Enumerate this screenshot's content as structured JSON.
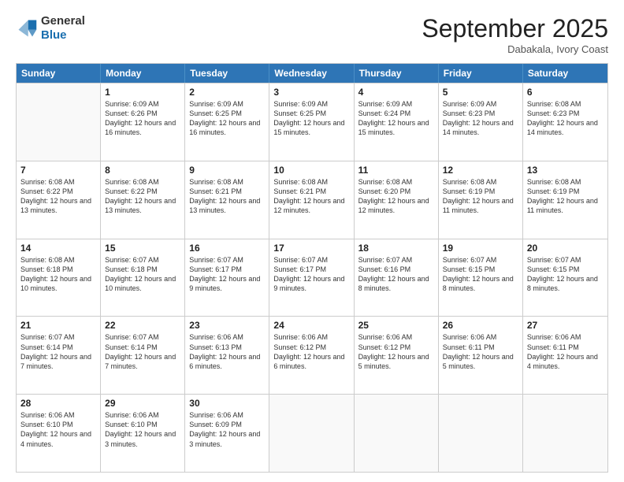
{
  "header": {
    "logo_general": "General",
    "logo_blue": "Blue",
    "month": "September 2025",
    "location": "Dabakala, Ivory Coast"
  },
  "days_of_week": [
    "Sunday",
    "Monday",
    "Tuesday",
    "Wednesday",
    "Thursday",
    "Friday",
    "Saturday"
  ],
  "rows": [
    [
      {
        "day": "",
        "sunrise": "",
        "sunset": "",
        "daylight": ""
      },
      {
        "day": "1",
        "sunrise": "Sunrise: 6:09 AM",
        "sunset": "Sunset: 6:26 PM",
        "daylight": "Daylight: 12 hours and 16 minutes."
      },
      {
        "day": "2",
        "sunrise": "Sunrise: 6:09 AM",
        "sunset": "Sunset: 6:25 PM",
        "daylight": "Daylight: 12 hours and 16 minutes."
      },
      {
        "day": "3",
        "sunrise": "Sunrise: 6:09 AM",
        "sunset": "Sunset: 6:25 PM",
        "daylight": "Daylight: 12 hours and 15 minutes."
      },
      {
        "day": "4",
        "sunrise": "Sunrise: 6:09 AM",
        "sunset": "Sunset: 6:24 PM",
        "daylight": "Daylight: 12 hours and 15 minutes."
      },
      {
        "day": "5",
        "sunrise": "Sunrise: 6:09 AM",
        "sunset": "Sunset: 6:23 PM",
        "daylight": "Daylight: 12 hours and 14 minutes."
      },
      {
        "day": "6",
        "sunrise": "Sunrise: 6:08 AM",
        "sunset": "Sunset: 6:23 PM",
        "daylight": "Daylight: 12 hours and 14 minutes."
      }
    ],
    [
      {
        "day": "7",
        "sunrise": "Sunrise: 6:08 AM",
        "sunset": "Sunset: 6:22 PM",
        "daylight": "Daylight: 12 hours and 13 minutes."
      },
      {
        "day": "8",
        "sunrise": "Sunrise: 6:08 AM",
        "sunset": "Sunset: 6:22 PM",
        "daylight": "Daylight: 12 hours and 13 minutes."
      },
      {
        "day": "9",
        "sunrise": "Sunrise: 6:08 AM",
        "sunset": "Sunset: 6:21 PM",
        "daylight": "Daylight: 12 hours and 13 minutes."
      },
      {
        "day": "10",
        "sunrise": "Sunrise: 6:08 AM",
        "sunset": "Sunset: 6:21 PM",
        "daylight": "Daylight: 12 hours and 12 minutes."
      },
      {
        "day": "11",
        "sunrise": "Sunrise: 6:08 AM",
        "sunset": "Sunset: 6:20 PM",
        "daylight": "Daylight: 12 hours and 12 minutes."
      },
      {
        "day": "12",
        "sunrise": "Sunrise: 6:08 AM",
        "sunset": "Sunset: 6:19 PM",
        "daylight": "Daylight: 12 hours and 11 minutes."
      },
      {
        "day": "13",
        "sunrise": "Sunrise: 6:08 AM",
        "sunset": "Sunset: 6:19 PM",
        "daylight": "Daylight: 12 hours and 11 minutes."
      }
    ],
    [
      {
        "day": "14",
        "sunrise": "Sunrise: 6:08 AM",
        "sunset": "Sunset: 6:18 PM",
        "daylight": "Daylight: 12 hours and 10 minutes."
      },
      {
        "day": "15",
        "sunrise": "Sunrise: 6:07 AM",
        "sunset": "Sunset: 6:18 PM",
        "daylight": "Daylight: 12 hours and 10 minutes."
      },
      {
        "day": "16",
        "sunrise": "Sunrise: 6:07 AM",
        "sunset": "Sunset: 6:17 PM",
        "daylight": "Daylight: 12 hours and 9 minutes."
      },
      {
        "day": "17",
        "sunrise": "Sunrise: 6:07 AM",
        "sunset": "Sunset: 6:17 PM",
        "daylight": "Daylight: 12 hours and 9 minutes."
      },
      {
        "day": "18",
        "sunrise": "Sunrise: 6:07 AM",
        "sunset": "Sunset: 6:16 PM",
        "daylight": "Daylight: 12 hours and 8 minutes."
      },
      {
        "day": "19",
        "sunrise": "Sunrise: 6:07 AM",
        "sunset": "Sunset: 6:15 PM",
        "daylight": "Daylight: 12 hours and 8 minutes."
      },
      {
        "day": "20",
        "sunrise": "Sunrise: 6:07 AM",
        "sunset": "Sunset: 6:15 PM",
        "daylight": "Daylight: 12 hours and 8 minutes."
      }
    ],
    [
      {
        "day": "21",
        "sunrise": "Sunrise: 6:07 AM",
        "sunset": "Sunset: 6:14 PM",
        "daylight": "Daylight: 12 hours and 7 minutes."
      },
      {
        "day": "22",
        "sunrise": "Sunrise: 6:07 AM",
        "sunset": "Sunset: 6:14 PM",
        "daylight": "Daylight: 12 hours and 7 minutes."
      },
      {
        "day": "23",
        "sunrise": "Sunrise: 6:06 AM",
        "sunset": "Sunset: 6:13 PM",
        "daylight": "Daylight: 12 hours and 6 minutes."
      },
      {
        "day": "24",
        "sunrise": "Sunrise: 6:06 AM",
        "sunset": "Sunset: 6:12 PM",
        "daylight": "Daylight: 12 hours and 6 minutes."
      },
      {
        "day": "25",
        "sunrise": "Sunrise: 6:06 AM",
        "sunset": "Sunset: 6:12 PM",
        "daylight": "Daylight: 12 hours and 5 minutes."
      },
      {
        "day": "26",
        "sunrise": "Sunrise: 6:06 AM",
        "sunset": "Sunset: 6:11 PM",
        "daylight": "Daylight: 12 hours and 5 minutes."
      },
      {
        "day": "27",
        "sunrise": "Sunrise: 6:06 AM",
        "sunset": "Sunset: 6:11 PM",
        "daylight": "Daylight: 12 hours and 4 minutes."
      }
    ],
    [
      {
        "day": "28",
        "sunrise": "Sunrise: 6:06 AM",
        "sunset": "Sunset: 6:10 PM",
        "daylight": "Daylight: 12 hours and 4 minutes."
      },
      {
        "day": "29",
        "sunrise": "Sunrise: 6:06 AM",
        "sunset": "Sunset: 6:10 PM",
        "daylight": "Daylight: 12 hours and 3 minutes."
      },
      {
        "day": "30",
        "sunrise": "Sunrise: 6:06 AM",
        "sunset": "Sunset: 6:09 PM",
        "daylight": "Daylight: 12 hours and 3 minutes."
      },
      {
        "day": "",
        "sunrise": "",
        "sunset": "",
        "daylight": ""
      },
      {
        "day": "",
        "sunrise": "",
        "sunset": "",
        "daylight": ""
      },
      {
        "day": "",
        "sunrise": "",
        "sunset": "",
        "daylight": ""
      },
      {
        "day": "",
        "sunrise": "",
        "sunset": "",
        "daylight": ""
      }
    ]
  ]
}
